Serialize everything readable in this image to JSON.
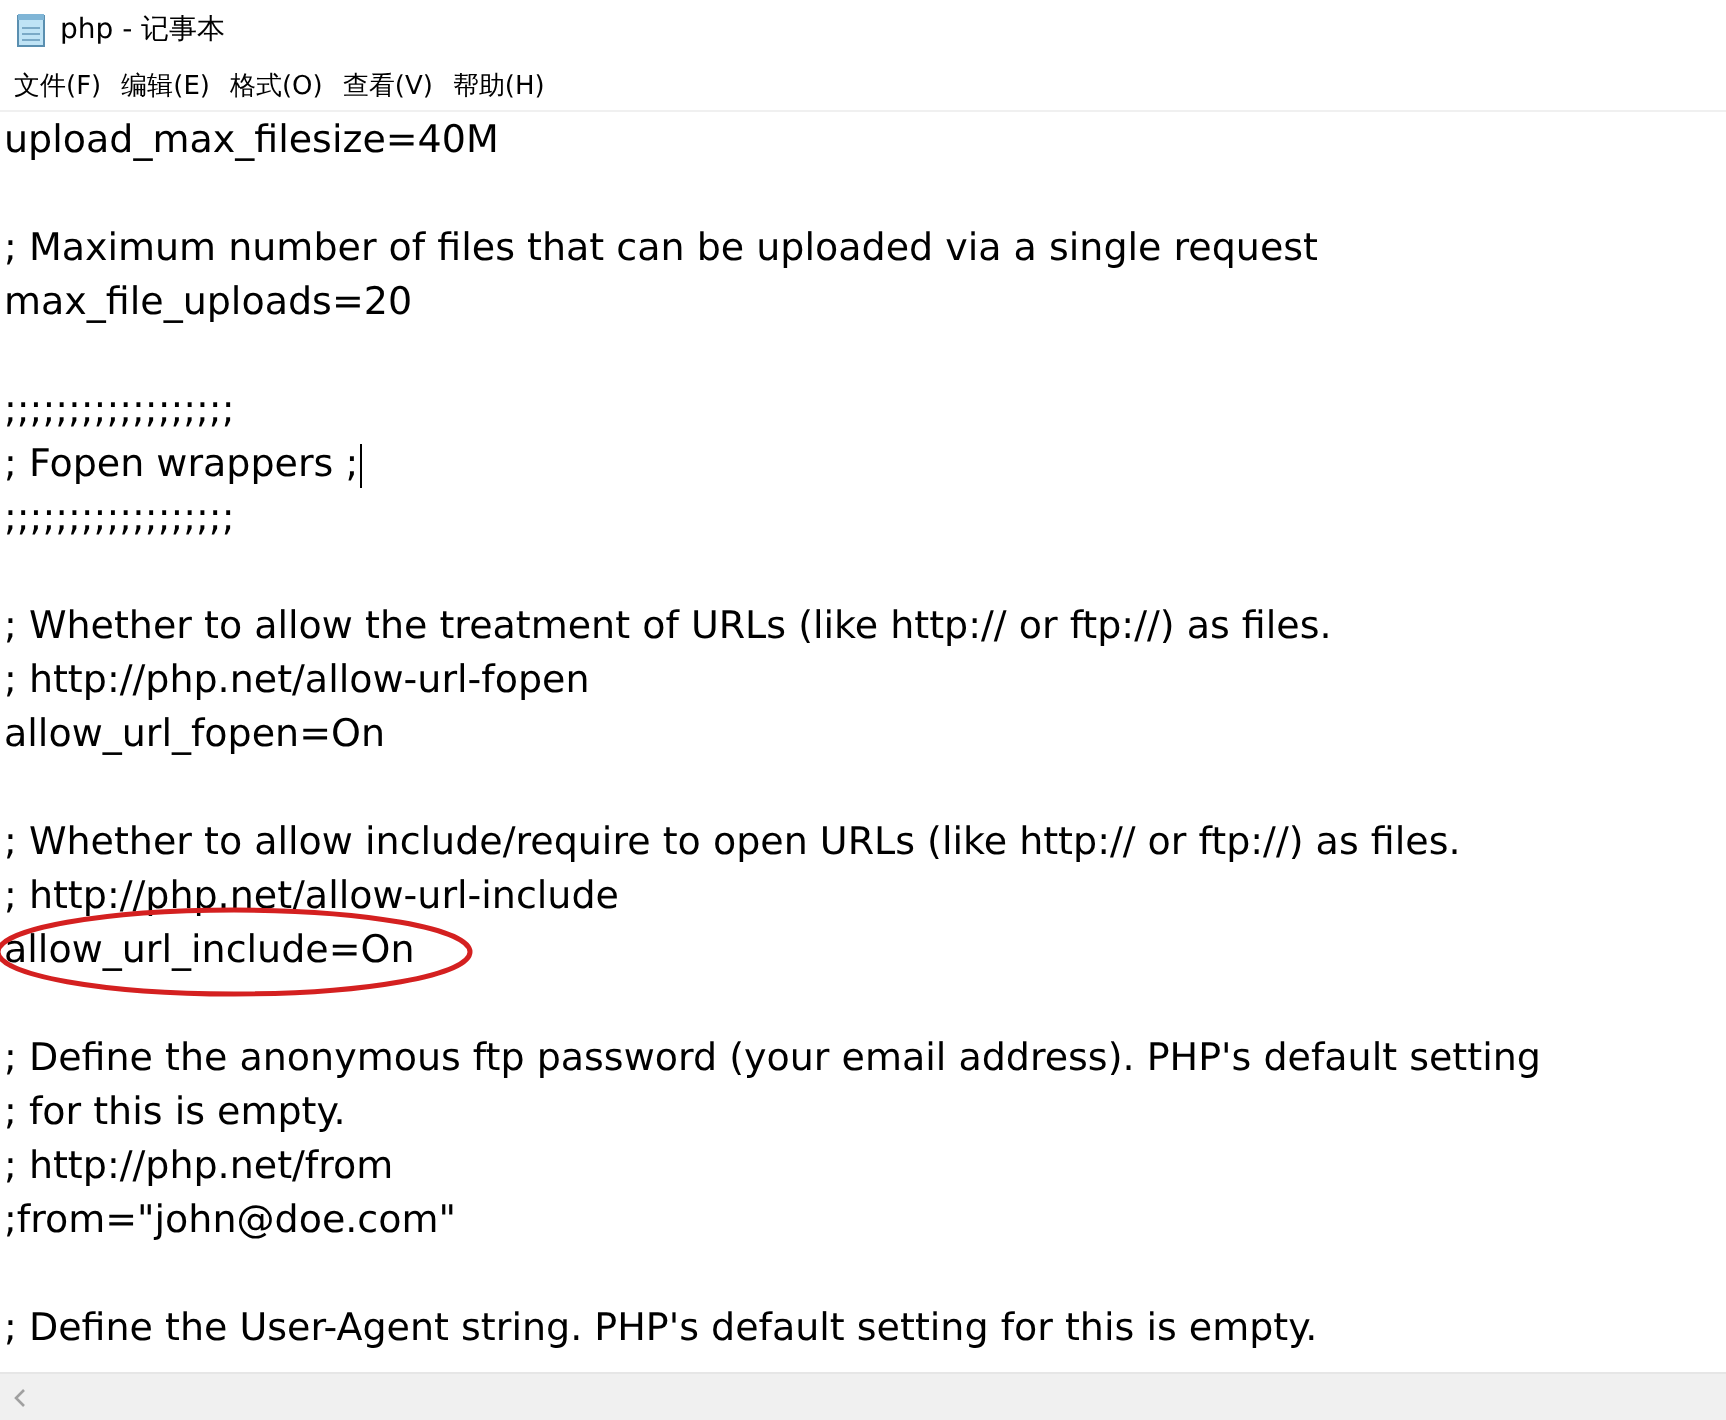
{
  "window": {
    "title": "php - 记事本"
  },
  "menu": [
    "文件(F)",
    "编辑(E)",
    "格式(O)",
    "查看(V)",
    "帮助(H)"
  ],
  "lines": [
    {
      "kind": "text",
      "text": "upload_max_filesize=40M",
      "circled": false,
      "cursor": false
    },
    {
      "kind": "blank"
    },
    {
      "kind": "text",
      "text": "; Maximum number of files that can be uploaded via a single request",
      "circled": false,
      "cursor": false
    },
    {
      "kind": "text",
      "text": "max_file_uploads=20",
      "circled": false,
      "cursor": false
    },
    {
      "kind": "blank"
    },
    {
      "kind": "text",
      "text": ";;;;;;;;;;;;;;;;;;",
      "circled": false,
      "cursor": false
    },
    {
      "kind": "text",
      "text": "; Fopen wrappers ;",
      "circled": false,
      "cursor": true
    },
    {
      "kind": "text",
      "text": ";;;;;;;;;;;;;;;;;;",
      "circled": false,
      "cursor": false
    },
    {
      "kind": "blank"
    },
    {
      "kind": "text",
      "text": "; Whether to allow the treatment of URLs (like http:// or ftp://) as files.",
      "circled": false,
      "cursor": false
    },
    {
      "kind": "text",
      "text": "; http://php.net/allow-url-fopen",
      "circled": false,
      "cursor": false
    },
    {
      "kind": "text",
      "text": "allow_url_fopen=On",
      "circled": false,
      "cursor": false
    },
    {
      "kind": "blank"
    },
    {
      "kind": "text",
      "text": "; Whether to allow include/require to open URLs (like http:// or ftp://) as files.",
      "circled": false,
      "cursor": false
    },
    {
      "kind": "text",
      "text": "; http://php.net/allow-url-include",
      "circled": false,
      "cursor": false
    },
    {
      "kind": "text",
      "text": "allow_url_include=On",
      "circled": true,
      "cursor": false
    },
    {
      "kind": "blank"
    },
    {
      "kind": "text",
      "text": "; Define the anonymous ftp password (your email address). PHP's default setting",
      "circled": false,
      "cursor": false
    },
    {
      "kind": "text",
      "text": "; for this is empty.",
      "circled": false,
      "cursor": false
    },
    {
      "kind": "text",
      "text": "; http://php.net/from",
      "circled": false,
      "cursor": false
    },
    {
      "kind": "text",
      "text": ";from=\"john@doe.com\"",
      "circled": false,
      "cursor": false
    },
    {
      "kind": "blank"
    },
    {
      "kind": "text",
      "text": "; Define the User-Agent string. PHP's default setting for this is empty.",
      "circled": false,
      "cursor": false
    }
  ]
}
